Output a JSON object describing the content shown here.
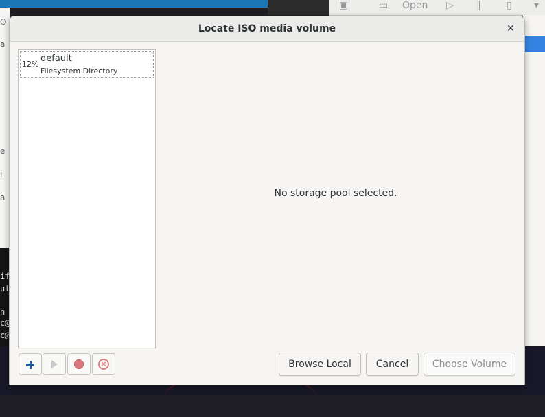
{
  "background": {
    "toolbar_open_label": "Open",
    "left_strip_letters": [
      "O",
      "a",
      "e",
      "i",
      "a"
    ],
    "terminal_lines": [
      "if",
      "ut",
      "n",
      "c@",
      "c@"
    ]
  },
  "dialog": {
    "title": "Locate ISO media volume",
    "pool_list": [
      {
        "percent": "12%",
        "name": "default",
        "type": "Filesystem Directory"
      }
    ],
    "empty_message": "No storage pool selected.",
    "buttons": {
      "browse_local": "Browse Local",
      "cancel": "Cancel",
      "choose_volume": "Choose Volume"
    }
  }
}
